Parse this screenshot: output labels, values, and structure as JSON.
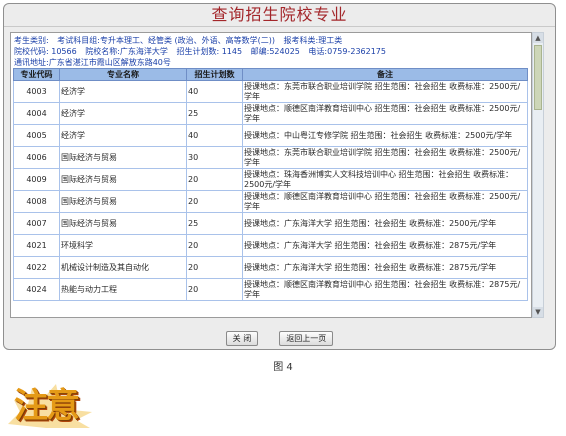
{
  "title": "查询招生院校专业",
  "info": {
    "line1_a": "考生类别:",
    "line1_b": "考试科目组:专升本理工、经管类 (政治、外语、高等数学(二))",
    "line1_c": "报考科类:理工类",
    "line2_a": "院校代码: 10566",
    "line2_b": "院校名称:广东海洋大学",
    "line2_c": "招生计划数: 1145",
    "line2_d": "邮编:524025",
    "line2_e": "电话:0759-2362175",
    "line3": "通讯地址:广东省湛江市霞山区解放东路40号"
  },
  "table": {
    "headers": [
      "专业代码",
      "专业名称",
      "招生计划数",
      "备注"
    ],
    "rows": [
      {
        "code": "4003",
        "name": "经济学",
        "plan": "40",
        "note": "授课地点：东莞市联合职业培训学院 招生范围：社会招生 收费标准：2500元/学年"
      },
      {
        "code": "4004",
        "name": "经济学",
        "plan": "25",
        "note": "授课地点：顺德区南洋教育培训中心 招生范围：社会招生 收费标准：2500元/学年"
      },
      {
        "code": "4005",
        "name": "经济学",
        "plan": "40",
        "note": "授课地点：中山粤江专修学院 招生范围：社会招生 收费标准：2500元/学年"
      },
      {
        "code": "4006",
        "name": "国际经济与贸易",
        "plan": "30",
        "note": "授课地点：东莞市联合职业培训学院 招生范围：社会招生 收费标准：2500元/学年"
      },
      {
        "code": "4009",
        "name": "国际经济与贸易",
        "plan": "20",
        "note": "授课地点：珠海香洲博实人文科技培训中心 招生范围：社会招生 收费标准：2500元/学年"
      },
      {
        "code": "4008",
        "name": "国际经济与贸易",
        "plan": "20",
        "note": "授课地点：顺德区南洋教育培训中心 招生范围：社会招生 收费标准：2500元/学年"
      },
      {
        "code": "4007",
        "name": "国际经济与贸易",
        "plan": "25",
        "note": "授课地点：广东海洋大学 招生范围：社会招生 收费标准：2500元/学年"
      },
      {
        "code": "4021",
        "name": "环境科学",
        "plan": "20",
        "note": "授课地点：广东海洋大学 招生范围：社会招生 收费标准：2875元/学年"
      },
      {
        "code": "4022",
        "name": "机械设计制造及其自动化",
        "plan": "20",
        "note": "授课地点：广东海洋大学 招生范围：社会招生 收费标准：2875元/学年"
      },
      {
        "code": "4024",
        "name": "热能与动力工程",
        "plan": "20",
        "note": "授课地点：顺德区南洋教育培训中心 招生范围：社会招生 收费标准：2875元/学年"
      }
    ]
  },
  "buttons": {
    "close": "关 闭",
    "back": "返回上一页"
  },
  "caption": "图 4",
  "stamp_text": "注意",
  "colors": {
    "title": "#a3262a",
    "info_text": "#1a3fa8",
    "header_bg": "#9bbbe7",
    "stamp": "#e59a17"
  }
}
